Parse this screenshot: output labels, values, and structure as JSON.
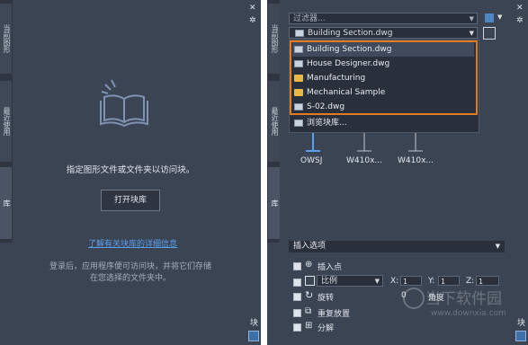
{
  "left_panel": {
    "tabs": [
      "当前图形",
      "最近使用",
      "库"
    ],
    "message": "指定图形文件或文件夹以访问块。",
    "open_button": "打开块库",
    "learn_link": "了解有关块库的详细信息",
    "note_lines": [
      "登录后，应用程序便可访问块，并将它们存储",
      "在您选择的文件夹中。"
    ],
    "side_label": "块",
    "icons": {
      "book": "open-book-icon",
      "close": "close-icon",
      "settings": "gear-icon"
    }
  },
  "right_panel": {
    "tabs": [
      "当前图形",
      "最近使用",
      "库"
    ],
    "filter_placeholder": "过滤器...",
    "file_select": "Building Section.dwg",
    "dropdown_items": [
      {
        "label": "Building Section.dwg",
        "kind": "dwg"
      },
      {
        "label": "House Designer.dwg",
        "kind": "dwg"
      },
      {
        "label": "Manufacturing",
        "kind": "folder"
      },
      {
        "label": "Mechanical Sample",
        "kind": "folder"
      },
      {
        "label": "S-02.dwg",
        "kind": "dwg"
      }
    ],
    "browse": "浏览块库...",
    "blocks": [
      "OWSJ",
      "W410x...",
      "W410x..."
    ],
    "insert_options_header": "插入选项",
    "insertion_point": "插入点",
    "scale_mode": "比例",
    "x_label": "X:",
    "x_value": "1",
    "y_label": "Y:",
    "y_value": "1",
    "z_label": "Z:",
    "z_value": "1",
    "rotate": "旋转",
    "angle_value": "0",
    "angle_label": "角度",
    "repeat": "重复放置",
    "explode": "分解",
    "side_label": "块"
  },
  "watermark": {
    "brand_cn": "当下软件园",
    "url": "www.downxia.com"
  },
  "colors": {
    "panel_bg": "#3b4453",
    "accent_orange": "#e07b22",
    "link_blue": "#5aa0ee"
  }
}
